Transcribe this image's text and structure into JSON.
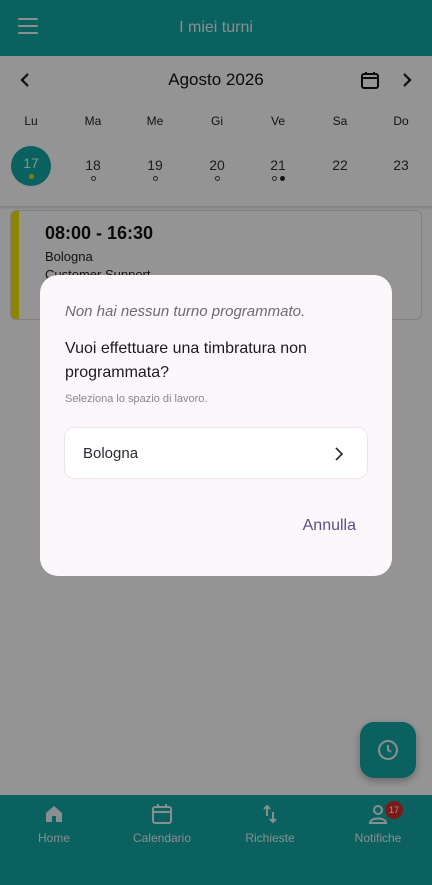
{
  "app_bar": {
    "title": "I miei turni",
    "menu_icon": "hamburger-menu-icon"
  },
  "calendar": {
    "month_label": "Agosto 2026",
    "weekdays": [
      "Lu",
      "Ma",
      "Me",
      "Gi",
      "Ve",
      "Sa",
      "Do"
    ],
    "days": [
      {
        "num": "17",
        "selected": true,
        "dots": [
          "yellow"
        ]
      },
      {
        "num": "18",
        "selected": false,
        "dots": [
          "ring"
        ]
      },
      {
        "num": "19",
        "selected": false,
        "dots": [
          "ring"
        ]
      },
      {
        "num": "20",
        "selected": false,
        "dots": [
          "ring"
        ]
      },
      {
        "num": "21",
        "selected": false,
        "dots": [
          "ring",
          "solid"
        ]
      },
      {
        "num": "22",
        "selected": false,
        "dots": []
      },
      {
        "num": "23",
        "selected": false,
        "dots": []
      }
    ]
  },
  "shift": {
    "time": "08:00 -  16:30",
    "location": "Bologna",
    "role": "Customer Support",
    "accent_color": "#f3e300"
  },
  "bottom_nav": {
    "items": [
      {
        "label": "Home",
        "icon": "home-icon"
      },
      {
        "label": "Calendario",
        "icon": "calendar-icon"
      },
      {
        "label": "Richieste",
        "icon": "swap-arrows-icon"
      },
      {
        "label": "Notifiche",
        "icon": "person-icon",
        "badge": "17"
      }
    ]
  },
  "dialog": {
    "info": "Non hai nessun turno programmato.",
    "question": "Vuoi effettuare una timbratura non programmata?",
    "hint": "Seleziona lo spazio di lavoro.",
    "workspace_value": "Bologna",
    "cancel_label": "Annulla"
  },
  "colors": {
    "primary": "#14a8a5",
    "dialog_bg": "#fbf7fb",
    "cancel_text": "#5b4f86",
    "badge": "#d62d2d"
  }
}
